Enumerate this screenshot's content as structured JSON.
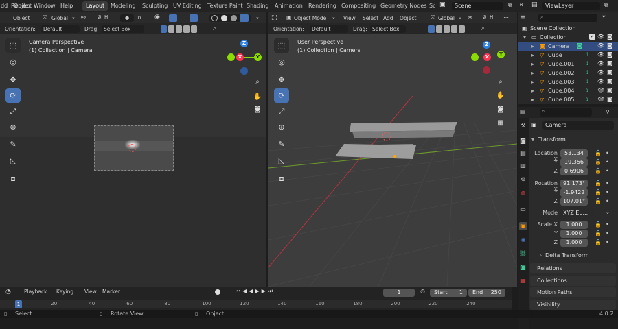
{
  "menu": [
    "dd",
    "Object",
    "Render",
    "Window",
    "Help"
  ],
  "workspaces": [
    "Layout",
    "Modeling",
    "Sculpting",
    "UV Editing",
    "Texture Paint",
    "Shading",
    "Animation",
    "Rendering",
    "Compositing",
    "Geometry Nodes",
    "Sc"
  ],
  "scene": "Scene",
  "view_layer": "ViewLayer",
  "left_viewport": {
    "header": {
      "object_label": "Object",
      "transform": "Global"
    },
    "tool_header": {
      "orientation_label": "Orientation:",
      "orientation": "Default",
      "drag_label": "Drag:",
      "drag": "Select Box"
    },
    "title": "Camera Perspective",
    "subtitle": "(1) Collection | Camera"
  },
  "right_viewport": {
    "header": {
      "mode": "Object Mode",
      "view": "View",
      "select": "Select",
      "add": "Add",
      "object": "Object",
      "transform": "Global"
    },
    "tool_header": {
      "orientation_label": "Orientation:",
      "orientation": "Default",
      "drag_label": "Drag:",
      "drag": "Select Box"
    },
    "title": "User Perspective",
    "subtitle": "(1) Collection | Camera"
  },
  "gizmo": {
    "z": "Z",
    "y": "Y",
    "x": "X"
  },
  "outliner": {
    "root": "Scene Collection",
    "collection": "Collection",
    "items": [
      "Camera",
      "Cube",
      "Cube.001",
      "Cube.002",
      "Cube.003",
      "Cube.004",
      "Cube.005"
    ]
  },
  "properties": {
    "object_name": "Camera",
    "transform_title": "Transform",
    "location_label": "Location X",
    "axis_y": "Y",
    "axis_z": "Z",
    "location": [
      "53.134",
      "19.356",
      "0.6906"
    ],
    "rotation_label": "Rotation X",
    "rotation": [
      "91.173°",
      "-1.9422",
      "107.01°"
    ],
    "mode_label": "Mode",
    "mode": "XYZ Eu...",
    "scale_label": "Scale X",
    "scale": [
      "1.000",
      "1.000",
      "1.000"
    ],
    "delta": "Delta Transform",
    "panels": [
      "Relations",
      "Collections",
      "Motion Paths",
      "Visibility"
    ]
  },
  "timeline": {
    "playback": "Playback",
    "keying": "Keying",
    "view": "View",
    "marker": "Marker",
    "current_frame": "1",
    "start_label": "Start",
    "start": "1",
    "end_label": "End",
    "end": "250",
    "ticks": [
      "1",
      "20",
      "40",
      "60",
      "80",
      "100",
      "120",
      "140",
      "160",
      "180",
      "200",
      "220",
      "240"
    ]
  },
  "status": {
    "select": "Select",
    "rotate": "Rotate View",
    "object": "Object",
    "version": "4.0.2"
  },
  "colors": {
    "accent": "#4772b3",
    "x_axis": "#ff3352",
    "y_axis": "#8bdc00",
    "z_axis": "#2f83e6",
    "selection": "#334d80"
  }
}
